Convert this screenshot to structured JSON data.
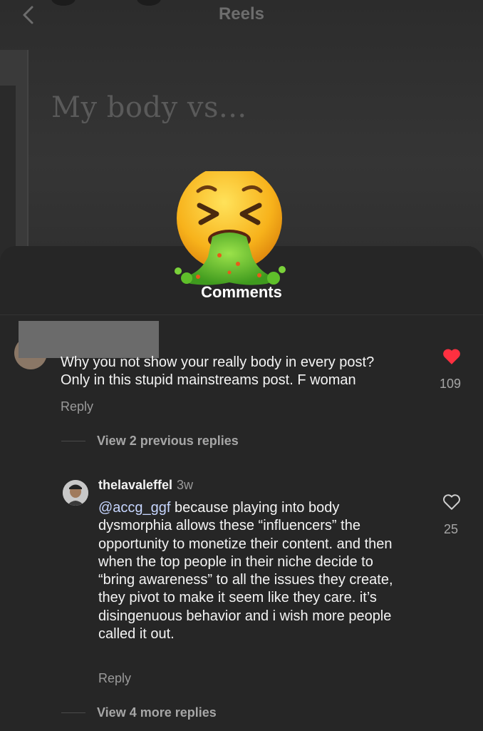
{
  "header": {
    "title": "Reels"
  },
  "video": {
    "overlay_text": "My body vs..."
  },
  "sheet": {
    "title": "Comments"
  },
  "comment1": {
    "text_line1": "Why you not show your really body in every post?",
    "text_line2": "Only in this stupid mainstreams post. F woman",
    "reply_label": "Reply",
    "likes": "109",
    "liked": true,
    "view_replies": "View 2 previous replies"
  },
  "comment2": {
    "username": "thelavaleffel",
    "time": "3w",
    "mention": "@accg_ggf",
    "text": " because playing into body dysmorphia allows these “influencers” the opportunity to monetize their content. and then when the top people in their niche decide to “bring awareness” to all the issues they create, they pivot to make it seem like they care. it’s disingenuous behavior and i wish more people called it out.",
    "reply_label": "Reply",
    "likes": "25",
    "liked": false,
    "view_replies": "View 4 more replies"
  },
  "colors": {
    "like_red": "#ff3040",
    "background": "#262626",
    "muted": "#9a9a9a"
  },
  "icons": [
    "back-chevron-icon",
    "nauseated-face-emoji",
    "heart-filled-icon",
    "heart-outline-icon"
  ]
}
